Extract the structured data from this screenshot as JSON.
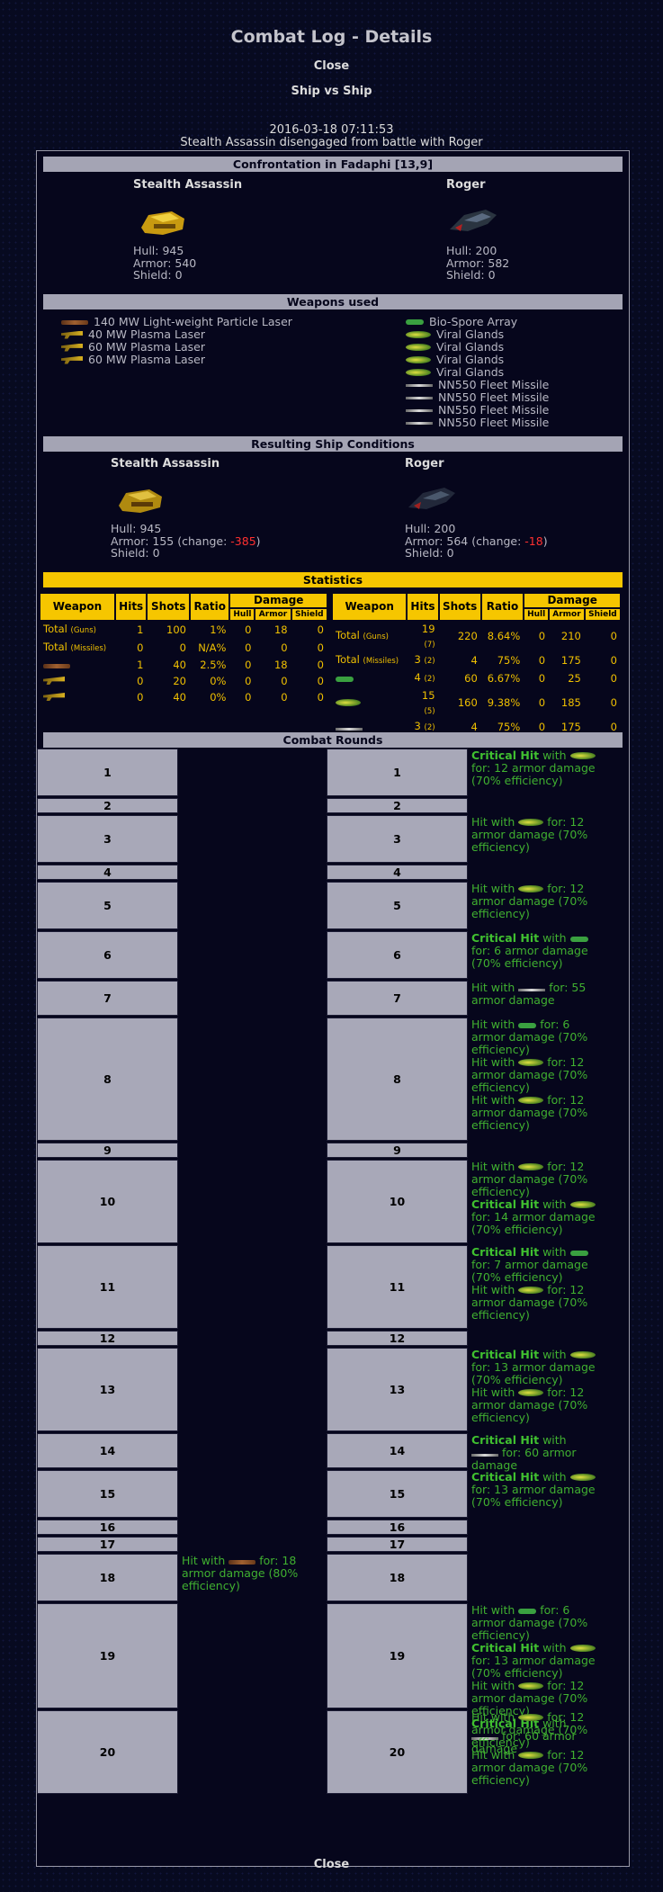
{
  "title": "Combat Log - Details",
  "close_label": "Close",
  "subtitle": "Ship vs Ship",
  "date": "2016-03-18 07:11:53",
  "summary": "Stealth Assassin disengaged from battle with Roger",
  "sections": {
    "confrontation": "Confrontation in Fadaphi [13,9]",
    "weapons": "Weapons used",
    "conditions": "Resulting Ship Conditions",
    "statistics": "Statistics",
    "rounds": "Combat Rounds"
  },
  "left_ship": {
    "name": "Stealth Assassin",
    "hull": "Hull: 945",
    "armor": "Armor: 540",
    "shield": "Shield: 0",
    "res_hull": "Hull: 945",
    "res_armor_pre": "Armor: 155 (change: ",
    "res_armor_change": "-385",
    "res_armor_post": ")",
    "res_shield": "Shield: 0",
    "weapons": [
      "140 MW Light-weight Particle Laser",
      "40 MW Plasma Laser",
      "60 MW Plasma Laser",
      "60 MW Plasma Laser"
    ]
  },
  "right_ship": {
    "name": "Roger",
    "hull": "Hull: 200",
    "armor": "Armor: 582",
    "shield": "Shield: 0",
    "res_hull": "Hull: 200",
    "res_armor_pre": "Armor: 564 (change: ",
    "res_armor_change": "-18",
    "res_armor_post": ")",
    "res_shield": "Shield: 0",
    "weapons": [
      "Bio-Spore Array",
      "Viral Glands",
      "Viral Glands",
      "Viral Glands",
      "Viral Glands",
      "NN550 Fleet Missile",
      "NN550 Fleet Missile",
      "NN550 Fleet Missile",
      "NN550 Fleet Missile"
    ]
  },
  "stats_headers": {
    "weapon": "Weapon",
    "hits": "Hits",
    "shots": "Shots",
    "ratio": "Ratio",
    "damage": "Damage",
    "hull": "Hull",
    "armor": "Armor",
    "shield": "Shield"
  },
  "stats_left": {
    "total_guns": {
      "label": "Total",
      "sub": "(Guns)",
      "hits": "1",
      "shots": "100",
      "ratio": "1%",
      "hull": "0",
      "armor": "18",
      "shield": "0"
    },
    "total_missiles": {
      "label": "Total",
      "sub": "(Missiles)",
      "hits": "0",
      "shots": "0",
      "ratio": "N/A%",
      "hull": "0",
      "armor": "0",
      "shield": "0"
    },
    "rows": [
      {
        "icon": "laser-icon",
        "hits": "1",
        "shots": "40",
        "ratio": "2.5%",
        "hull": "0",
        "armor": "18",
        "shield": "0"
      },
      {
        "icon": "plasma-icon",
        "hits": "0",
        "shots": "20",
        "ratio": "0%",
        "hull": "0",
        "armor": "0",
        "shield": "0"
      },
      {
        "icon": "plasma-icon",
        "hits": "0",
        "shots": "40",
        "ratio": "0%",
        "hull": "0",
        "armor": "0",
        "shield": "0"
      }
    ]
  },
  "stats_right": {
    "total_guns": {
      "label": "Total",
      "sub": "(Guns)",
      "hits": "19",
      "hits_sub": "(7)",
      "shots": "220",
      "ratio": "8.64%",
      "hull": "0",
      "armor": "210",
      "shield": "0"
    },
    "total_missiles": {
      "label": "Total",
      "sub": "(Missiles)",
      "hits": "3",
      "hits_sub": "(2)",
      "shots": "4",
      "ratio": "75%",
      "hull": "0",
      "armor": "175",
      "shield": "0"
    },
    "rows": [
      {
        "icon": "spore-icon",
        "hits": "4",
        "hits_sub": "(2)",
        "shots": "60",
        "ratio": "6.67%",
        "hull": "0",
        "armor": "25",
        "shield": "0"
      },
      {
        "icon": "gland-icon",
        "hits": "15",
        "hits_sub": "(5)",
        "shots": "160",
        "ratio": "9.38%",
        "hull": "0",
        "armor": "185",
        "shield": "0"
      },
      {
        "icon": "missile-icon",
        "hits": "3",
        "hits_sub": "(2)",
        "shots": "4",
        "ratio": "75%",
        "hull": "0",
        "armor": "175",
        "shield": "0"
      }
    ]
  },
  "rounds": [
    {
      "n": "1",
      "right": [
        [
          "Critical Hit",
          " with ",
          "gland",
          "for: 12 armor damage (70% efficiency)"
        ]
      ]
    },
    {
      "n": "2",
      "right": []
    },
    {
      "n": "3",
      "right": [
        [
          "Hit",
          " with ",
          "gland",
          "for: 12 armor damage (70% efficiency)"
        ]
      ]
    },
    {
      "n": "4",
      "right": []
    },
    {
      "n": "5",
      "right": [
        [
          "Hit",
          " with ",
          "gland",
          "for: 12 armor damage (70% efficiency)"
        ]
      ]
    },
    {
      "n": "6",
      "right": [
        [
          "Critical Hit",
          " with ",
          "spore",
          "for: 6 armor damage (70% efficiency)"
        ]
      ]
    },
    {
      "n": "7",
      "right": [
        [
          "Hit",
          " with ",
          "missile",
          "for: 55 armor damage"
        ]
      ]
    },
    {
      "n": "8",
      "right": [
        [
          "Hit",
          " with ",
          "spore",
          "for: 6 armor damage (70% efficiency)"
        ],
        [
          "Hit",
          " with ",
          "gland",
          "for: 12 armor damage (70% efficiency)"
        ],
        [
          "Hit",
          " with ",
          "gland",
          "for: 12 armor damage (70% efficiency)"
        ]
      ]
    },
    {
      "n": "9",
      "right": []
    },
    {
      "n": "10",
      "right": [
        [
          "Hit",
          " with ",
          "gland",
          "for: 12 armor damage (70% efficiency)"
        ],
        [
          "Critical Hit",
          " with ",
          "gland",
          "for: 14 armor damage (70% efficiency)"
        ]
      ]
    },
    {
      "n": "11",
      "right": [
        [
          "Critical Hit",
          " with ",
          "spore",
          "for: 7 armor damage (70% efficiency)"
        ],
        [
          "Hit",
          " with ",
          "gland",
          "for: 12 armor damage (70% efficiency)"
        ]
      ]
    },
    {
      "n": "12",
      "right": []
    },
    {
      "n": "13",
      "right": [
        [
          "Critical Hit",
          " with ",
          "gland",
          "for: 13 armor damage (70% efficiency)"
        ],
        [
          "Hit",
          " with ",
          "gland",
          "for: 12 armor damage (70% efficiency)"
        ]
      ]
    },
    {
      "n": "14",
      "right": [
        [
          "Critical Hit",
          " with ",
          "missile",
          "for: 60 armor damage"
        ]
      ]
    },
    {
      "n": "15",
      "right": [
        [
          "Critical Hit",
          " with ",
          "gland",
          "for: 13 armor damage (70% efficiency)"
        ]
      ]
    },
    {
      "n": "16",
      "right": []
    },
    {
      "n": "17",
      "right": []
    },
    {
      "n": "18",
      "left": [
        [
          "Hit",
          " with ",
          "laser",
          "for: 18 armor damage (80% efficiency)"
        ]
      ],
      "right": []
    },
    {
      "n": "19",
      "right": [
        [
          "Hit",
          " with ",
          "spore",
          "for: 6 armor damage (70% efficiency)"
        ],
        [
          "Critical Hit",
          " with ",
          "gland",
          "for: 13 armor damage (70% efficiency)"
        ],
        [
          "Hit",
          " with ",
          "gland",
          "for: 12 armor damage (70% efficiency)"
        ],
        [
          "Critical Hit",
          " with ",
          "missile",
          "for: 60 armor damage"
        ]
      ]
    },
    {
      "n": "20",
      "right": [
        [
          "Hit",
          " with ",
          "gland",
          "for: 12 armor damage (70% efficiency)"
        ],
        [
          "Hit",
          " with ",
          "gland",
          "for: 12 armor damage (70% efficiency)"
        ]
      ]
    }
  ]
}
